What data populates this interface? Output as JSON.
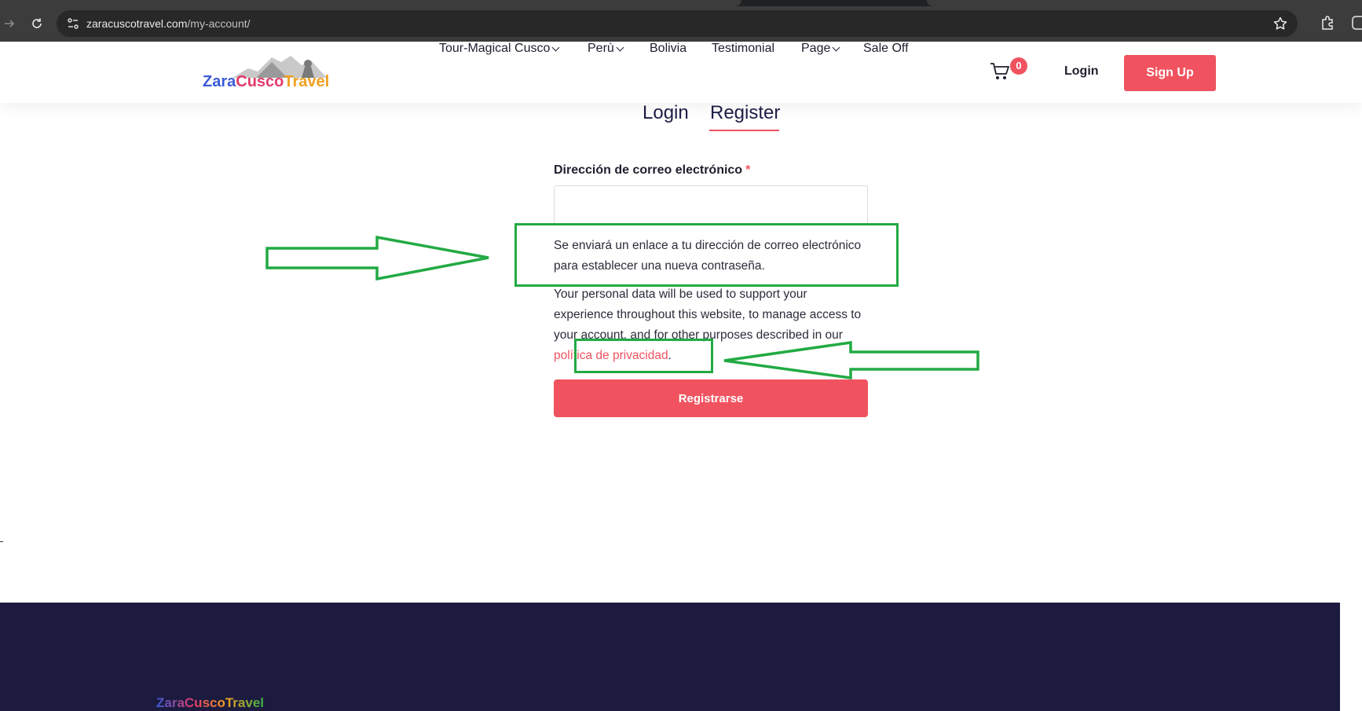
{
  "browser": {
    "url_host": "zaracuscotravel.com",
    "url_path": "/my-account/"
  },
  "header": {
    "logo_text_parts": [
      "Zara",
      "Cusco",
      "Travel"
    ],
    "nav": [
      {
        "label": "Tour-Magical Cusco",
        "has_dropdown": true
      },
      {
        "label": "Perù",
        "has_dropdown": true
      },
      {
        "label": "Bolivia",
        "has_dropdown": false
      },
      {
        "label": "Testimonial",
        "has_dropdown": false
      },
      {
        "label": "Page",
        "has_dropdown": true
      },
      {
        "label": "Sale Off",
        "has_dropdown": false
      }
    ],
    "cart_count": "0",
    "login_label": "Login",
    "signup_label": "Sign Up"
  },
  "tabs": {
    "login": "Login",
    "register": "Register",
    "active": "Register"
  },
  "form": {
    "email_label": "Dirección de correo electrónico",
    "required_mark": "*",
    "email_value": "",
    "notice": "Se enviará un enlace a tu dirección de correo electrónico para establecer una nueva contraseña.",
    "privacy_text": "Your personal data will be used to support your experience throughout this website, to manage access to your account, and for other purposes described in our",
    "privacy_link": "política de privacidad",
    "privacy_end": ".",
    "submit_label": "Registrarse"
  },
  "footer": {
    "logo_text": "ZaraCuscoTravel"
  },
  "colors": {
    "accent": "#f0535f",
    "navy": "#1c1b3f",
    "annotation": "#22aa44",
    "chrome_bar": "#3c3c3c"
  }
}
